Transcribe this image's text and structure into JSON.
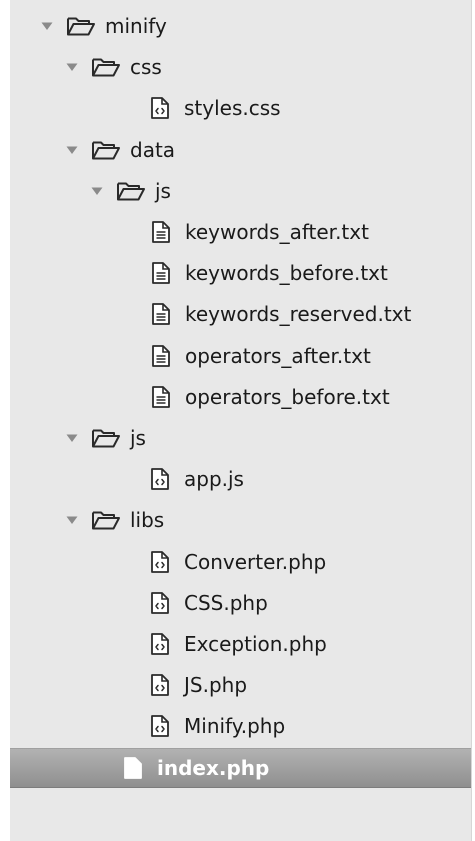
{
  "tree": {
    "items": [
      {
        "label": "minify",
        "kind": "folder",
        "expanded": true,
        "depth": 0
      },
      {
        "label": "css",
        "kind": "folder",
        "expanded": true,
        "depth": 1
      },
      {
        "label": "styles.css",
        "kind": "code-file",
        "depth": 2
      },
      {
        "label": "data",
        "kind": "folder",
        "expanded": true,
        "depth": 1
      },
      {
        "label": "js",
        "kind": "folder",
        "expanded": true,
        "depth": 2
      },
      {
        "label": "keywords_after.txt",
        "kind": "text-file",
        "depth": 3
      },
      {
        "label": "keywords_before.txt",
        "kind": "text-file",
        "depth": 3
      },
      {
        "label": "keywords_reserved.txt",
        "kind": "text-file",
        "depth": 3
      },
      {
        "label": "operators_after.txt",
        "kind": "text-file",
        "depth": 3
      },
      {
        "label": "operators_before.txt",
        "kind": "text-file",
        "depth": 3
      },
      {
        "label": "js",
        "kind": "folder",
        "expanded": true,
        "depth": 1
      },
      {
        "label": "app.js",
        "kind": "code-file",
        "depth": 2
      },
      {
        "label": "libs",
        "kind": "folder",
        "expanded": true,
        "depth": 1
      },
      {
        "label": "Converter.php",
        "kind": "code-file",
        "depth": 2
      },
      {
        "label": "CSS.php",
        "kind": "code-file",
        "depth": 2
      },
      {
        "label": "Exception.php",
        "kind": "code-file",
        "depth": 2
      },
      {
        "label": "JS.php",
        "kind": "code-file",
        "depth": 2
      },
      {
        "label": "Minify.php",
        "kind": "code-file",
        "depth": 2
      },
      {
        "label": "index.php",
        "kind": "code-file",
        "depth": 1,
        "selected": true
      }
    ]
  },
  "colors": {
    "sidebar_background": "#e8e8e8",
    "selection_background": "#a0a0a0",
    "selected_text": "#ffffff",
    "disclosure_triangle": "#8a8a8a",
    "icon_stroke": "#2a2a2a"
  },
  "icons": {
    "disclosure": "disclosure-triangle-expanded-icon",
    "folder": "folder-open-icon",
    "code-file": "code-file-icon",
    "text-file": "text-file-icon"
  }
}
